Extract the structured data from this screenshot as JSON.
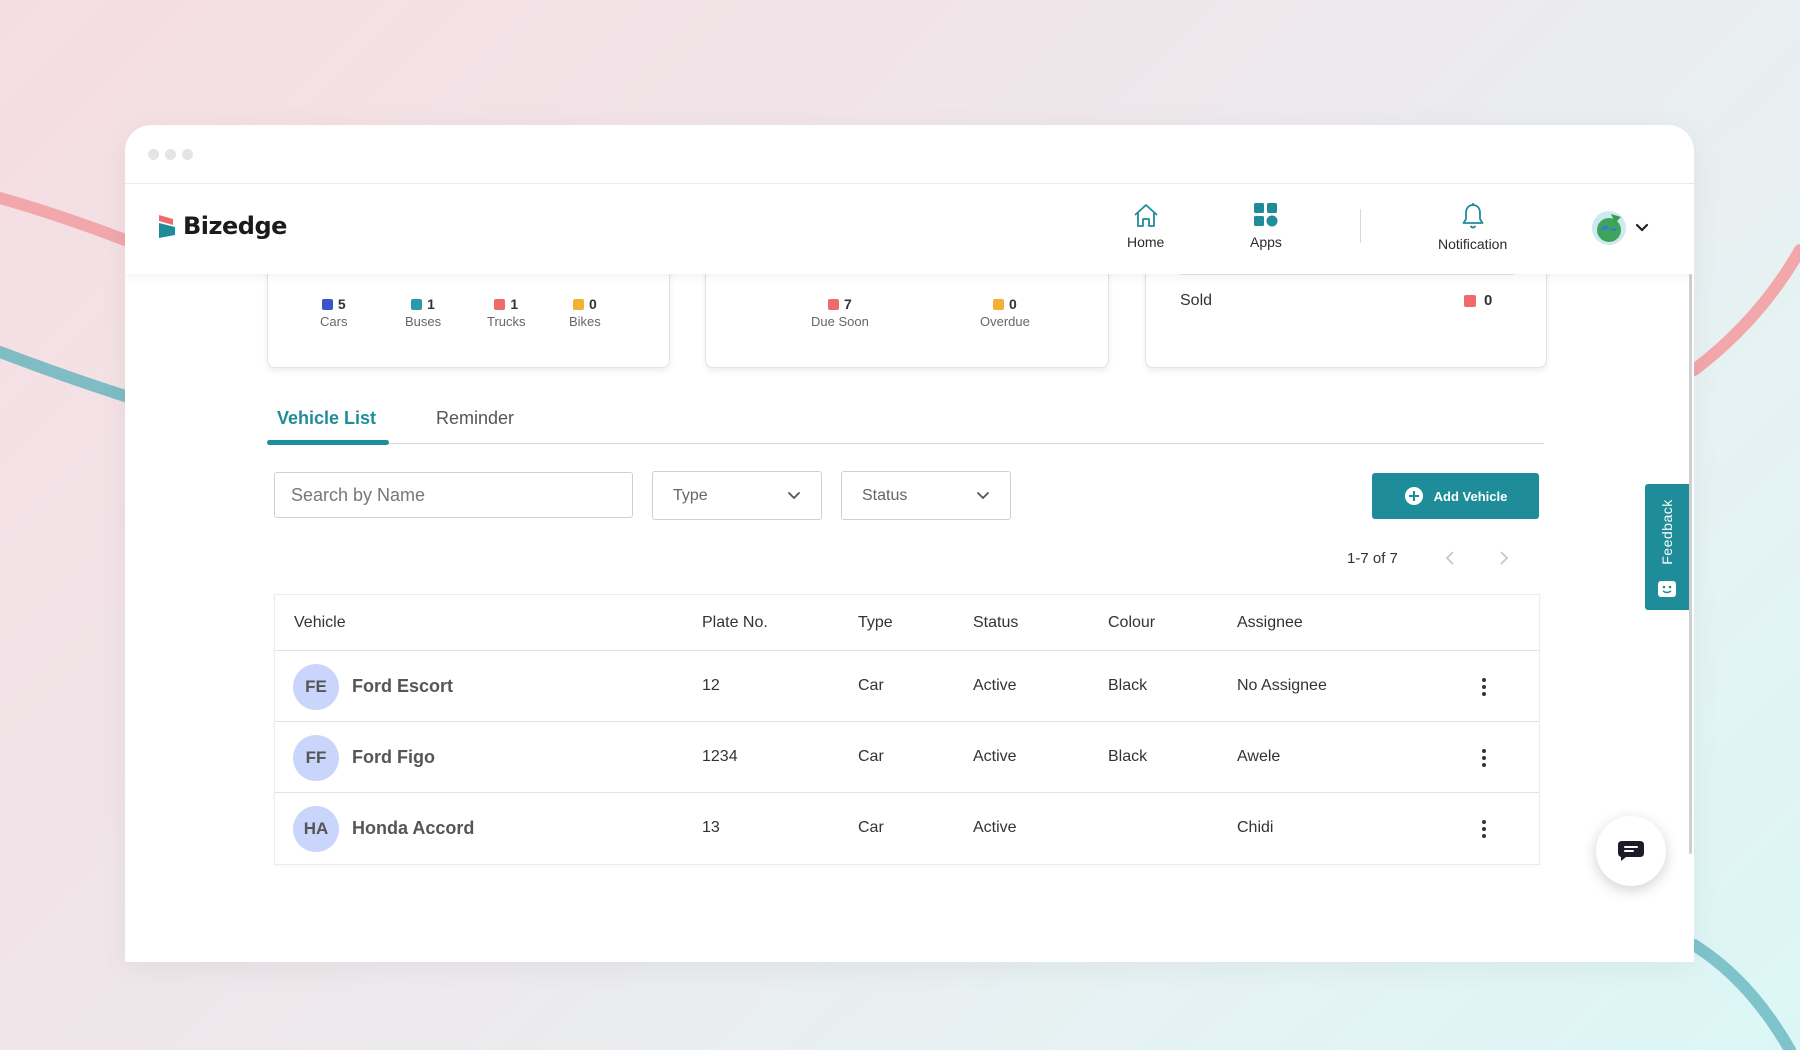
{
  "brand": {
    "name": "Bizedge"
  },
  "nav": [
    {
      "label": "Home",
      "icon": "home-icon"
    },
    {
      "label": "Apps",
      "icon": "apps-grid-icon"
    },
    {
      "label": "Notification",
      "icon": "bell-icon"
    }
  ],
  "summary": {
    "fleet": [
      {
        "count": "5",
        "label": "Cars",
        "color": "#3a55c9"
      },
      {
        "count": "1",
        "label": "Buses",
        "color": "#2a9aa3"
      },
      {
        "count": "1",
        "label": "Trucks",
        "color": "#ef6b6b"
      },
      {
        "count": "0",
        "label": "Bikes",
        "color": "#f2b134"
      }
    ],
    "reminders": [
      {
        "count": "7",
        "label": "Due Soon",
        "color": "#ef6b6b"
      },
      {
        "count": "0",
        "label": "Overdue",
        "color": "#f2b134"
      }
    ],
    "status": {
      "label": "Sold",
      "count": "0",
      "color": "#ef6b6b"
    }
  },
  "tabs": [
    {
      "label": "Vehicle List",
      "active": true
    },
    {
      "label": "Reminder",
      "active": false
    }
  ],
  "filters": {
    "search_placeholder": "Search by Name",
    "type_label": "Type",
    "status_label": "Status",
    "add_button": "Add Vehicle"
  },
  "pagination": {
    "text": "1-7 of 7"
  },
  "table": {
    "headers": [
      "Vehicle",
      "Plate No.",
      "Type",
      "Status",
      "Colour",
      "Assignee"
    ],
    "rows": [
      {
        "initials": "FE",
        "vehicle": "Ford Escort",
        "plate": "12",
        "type": "Car",
        "status": "Active",
        "colour": "Black",
        "assignee": "No Assignee"
      },
      {
        "initials": "FF",
        "vehicle": "Ford Figo",
        "plate": "1234",
        "type": "Car",
        "status": "Active",
        "colour": "Black",
        "assignee": "Awele"
      },
      {
        "initials": "HA",
        "vehicle": "Honda Accord",
        "plate": "13",
        "type": "Car",
        "status": "Active",
        "colour": "",
        "assignee": "Chidi"
      }
    ]
  },
  "feedback": {
    "label": "Feedback"
  },
  "colors": {
    "accent": "#1f8d99",
    "avatar_bg": "#c9d5fb"
  }
}
